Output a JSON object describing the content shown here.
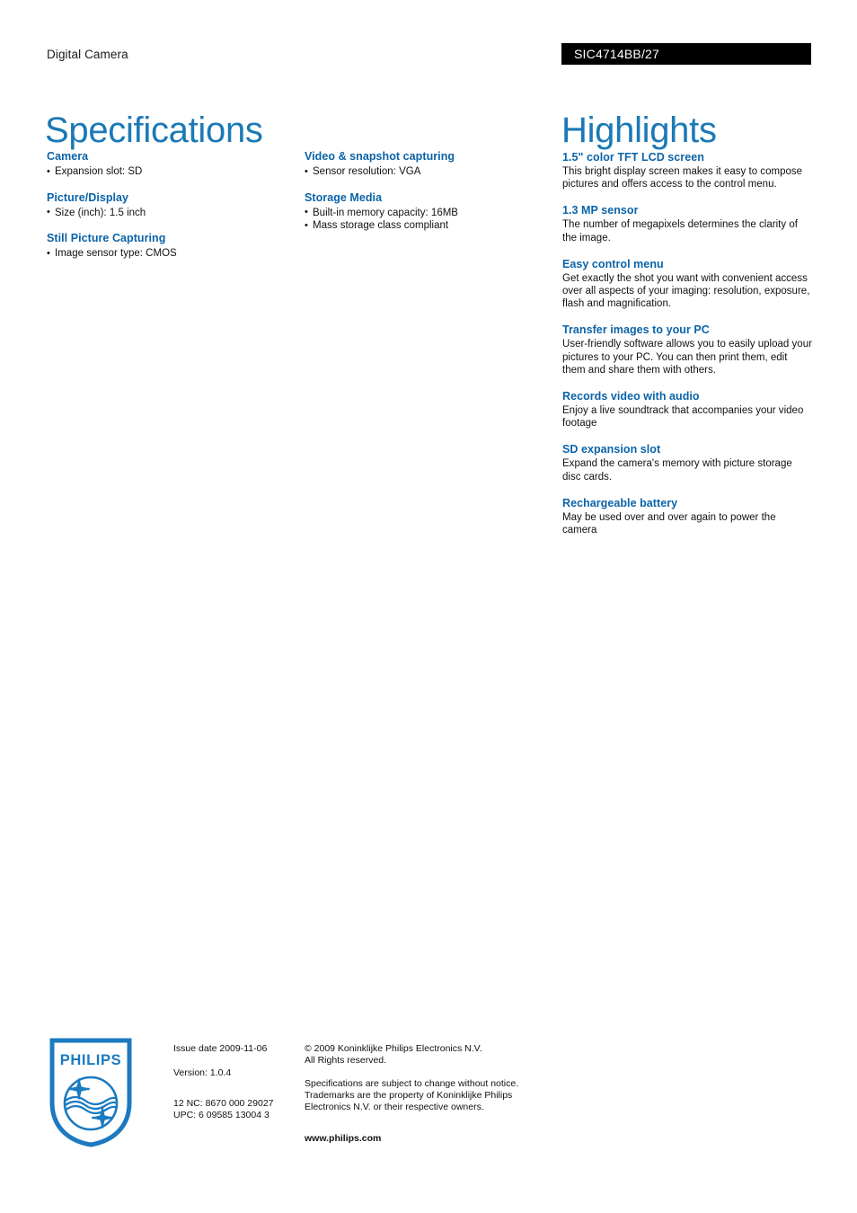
{
  "header": {
    "category": "Digital Camera",
    "model_code": "SIC4714BB/27"
  },
  "titles": {
    "specifications": "Specifications",
    "highlights": "Highlights"
  },
  "colors": {
    "title_blue": "#1b79b6",
    "heading_blue": "#0b63a8",
    "logo_blue": "#1b7ac0",
    "model_bar_bg": "#000000",
    "body_text": "#111111"
  },
  "specifications": {
    "column1": [
      {
        "heading": "Camera",
        "items": [
          "Expansion slot: SD"
        ]
      },
      {
        "heading": "Picture/Display",
        "items": [
          "Size (inch): 1.5 inch"
        ]
      },
      {
        "heading": "Still Picture Capturing",
        "items": [
          "Image sensor type: CMOS"
        ]
      }
    ],
    "column2": [
      {
        "heading": "Video & snapshot capturing",
        "items": [
          "Sensor resolution: VGA"
        ]
      },
      {
        "heading": "Storage Media",
        "items": [
          "Built-in memory capacity: 16MB",
          "Mass storage class compliant"
        ]
      }
    ]
  },
  "highlights": [
    {
      "heading": "1.5\" color TFT LCD screen",
      "body": "This bright display screen makes it easy to compose pictures and offers access to the control menu."
    },
    {
      "heading": "1.3 MP sensor",
      "body": "The number of megapixels determines the clarity of the image."
    },
    {
      "heading": "Easy control menu",
      "body": "Get exactly the shot you want with convenient access over all aspects of your imaging: resolution, exposure, flash and magnification."
    },
    {
      "heading": "Transfer images to your PC",
      "body": "User-friendly software allows you to easily upload your pictures to your PC. You can then print them, edit them and share them with others."
    },
    {
      "heading": "Records video with audio",
      "body": "Enjoy a live soundtrack that accompanies your video footage"
    },
    {
      "heading": "SD expansion slot",
      "body": "Expand the camera's memory with picture storage disc cards."
    },
    {
      "heading": "Rechargeable battery",
      "body": "May be used over and over again to power the camera"
    }
  ],
  "footer": {
    "logo_wordmark": "PHILIPS",
    "issue_date": "Issue date 2009-11-06",
    "version": "Version: 1.0.4",
    "nc_code": "12 NC: 8670 000 29027",
    "upc_code": "UPC: 6 09585 13004 3",
    "copyright_line1": "© 2009 Koninklijke Philips Electronics N.V.",
    "copyright_line2": "All Rights reserved.",
    "disclaimer_line1": "Specifications are subject to change without notice.",
    "disclaimer_line2": "Trademarks are the property of Koninklijke Philips",
    "disclaimer_line3": "Electronics N.V. or their respective owners.",
    "website": "www.philips.com"
  }
}
